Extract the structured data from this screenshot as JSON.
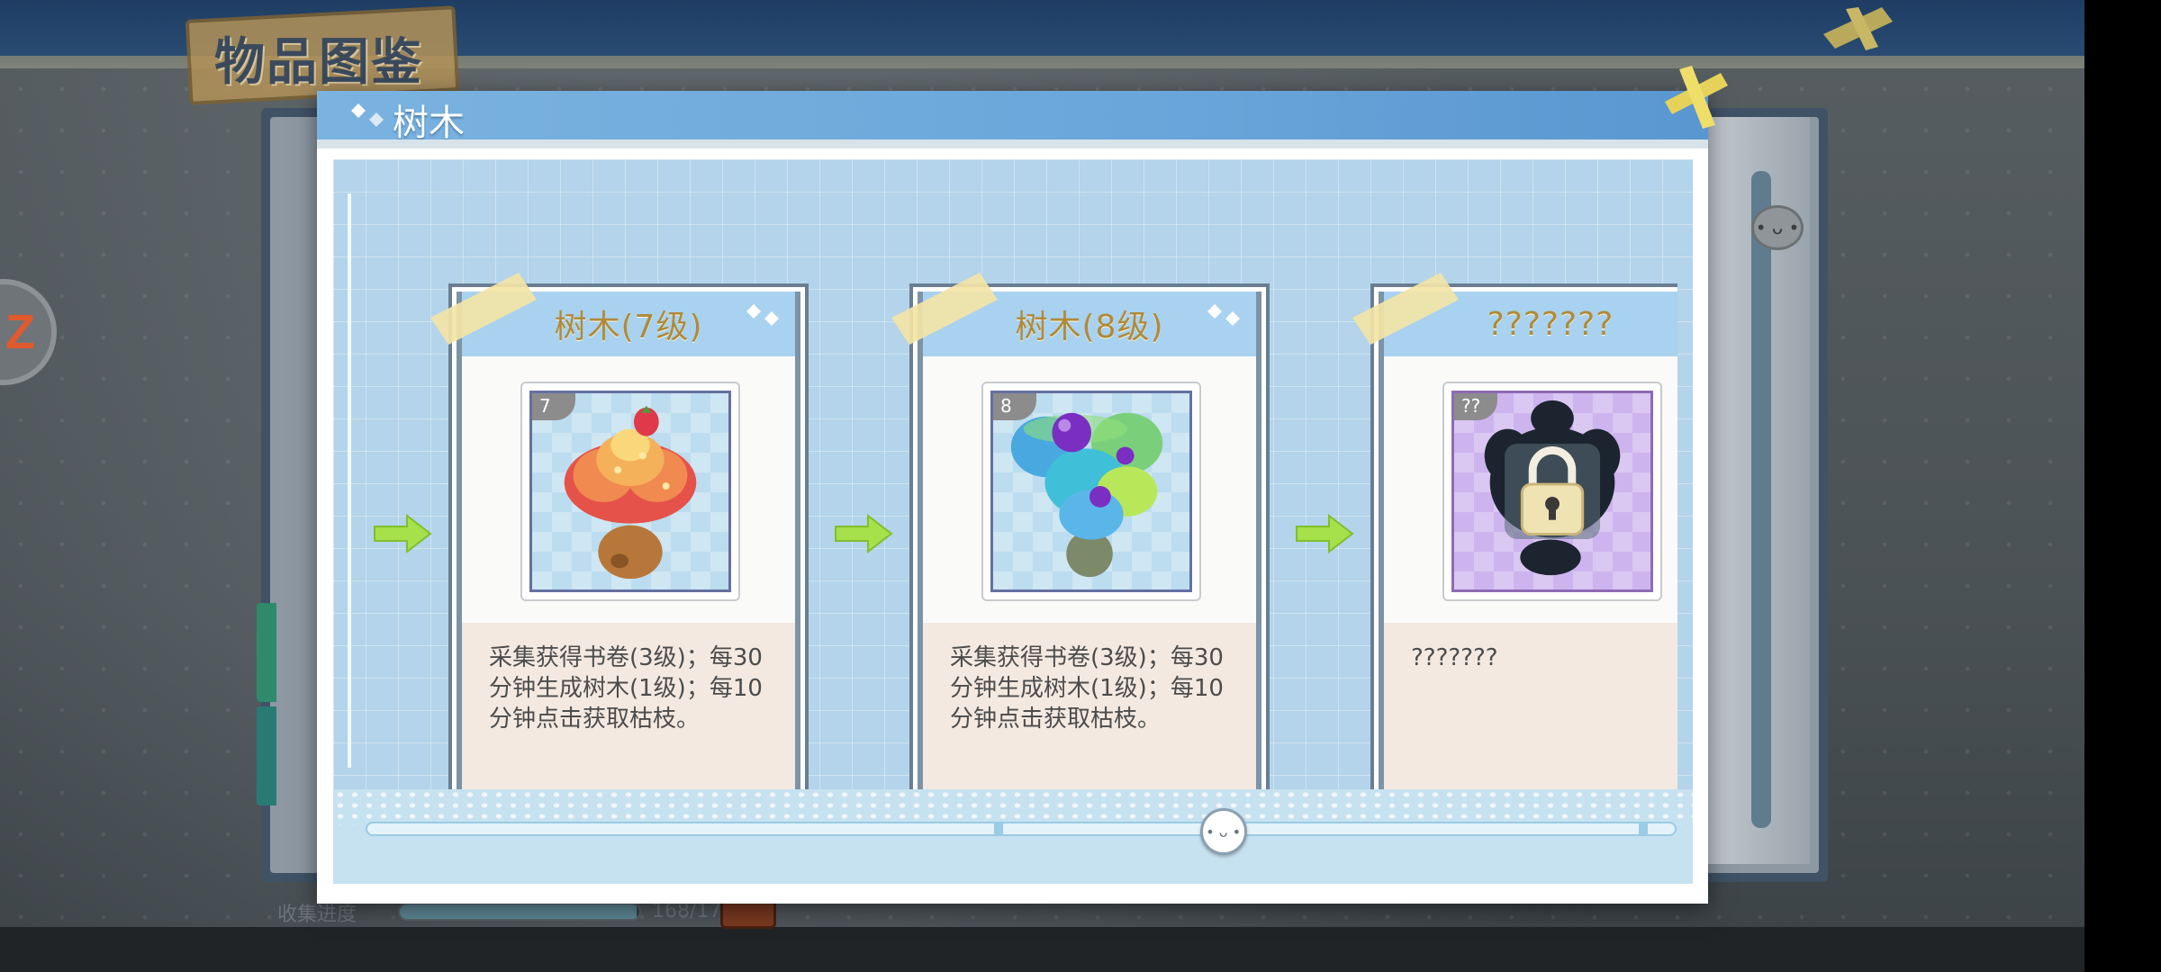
{
  "background": {
    "title": "物品图鉴",
    "side_badge": "Z",
    "progress": {
      "label": "收集进度",
      "current": 168,
      "total": 170,
      "count_text": "168/170"
    }
  },
  "dialog": {
    "title": "树木",
    "cards": [
      {
        "name": "树木(7级)",
        "level": "7",
        "tile_color": "blue",
        "description": "采集获得书卷(3级)；每30分钟生成树木(1级)；每10分钟点击获取枯枝。",
        "locked": false
      },
      {
        "name": "树木(8级)",
        "level": "8",
        "tile_color": "blue",
        "description": "采集获得书卷(3级)；每30分钟生成树木(1级)；每10分钟点击获取枯枝。",
        "locked": false
      },
      {
        "name": "???????",
        "level": "??",
        "tile_color": "purple",
        "description": "???????",
        "locked": true
      }
    ],
    "scroll": {
      "position": 0.66,
      "thumb_icon": "smiley-face-icon"
    }
  },
  "colors": {
    "header_blue": "#6aa6da",
    "card_title_gold": "#b08a3a",
    "body_blue": "#b3d4ea",
    "arrow_green": "#a6e04a"
  },
  "icons": [
    "tape-icon",
    "arrow-right-icon",
    "lock-icon",
    "smiley-face-icon",
    "diamond-sparkle-icon"
  ]
}
